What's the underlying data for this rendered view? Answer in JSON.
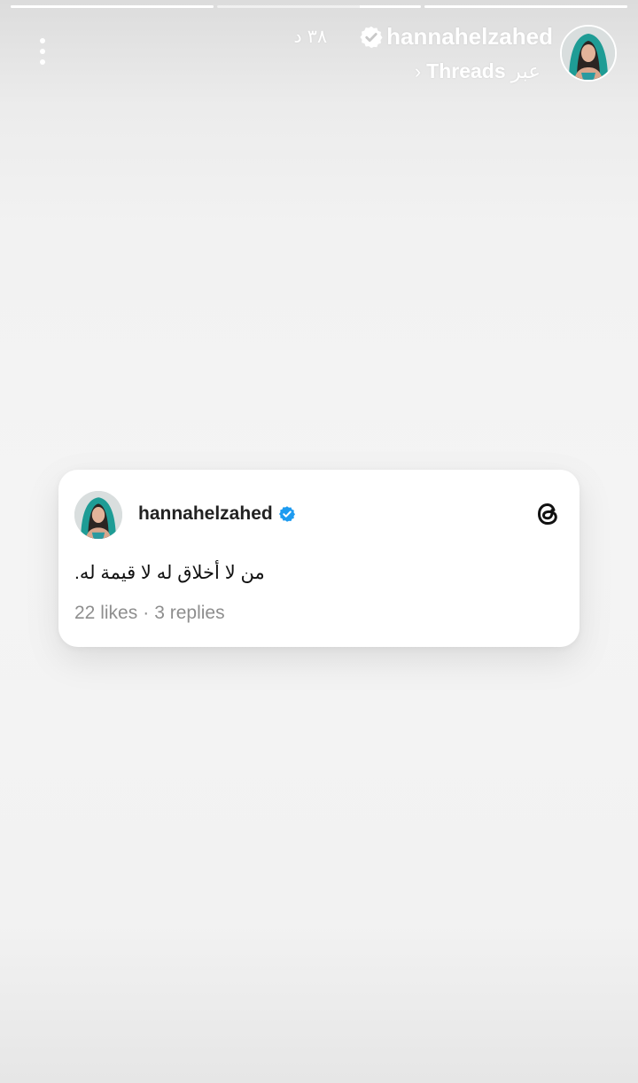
{
  "story": {
    "progress": [
      1,
      0.3,
      1
    ],
    "username": "hannahelzahed",
    "time_ago": "٣٨ د",
    "via_prefix": "عبر",
    "via_app": "Threads",
    "via_chevron": "›"
  },
  "card": {
    "username": "hannahelzahed",
    "text": "من لا أخلاق له لا قيمة له.",
    "likes": "22 likes",
    "separator": "·",
    "replies": "3 replies"
  },
  "colors": {
    "verified_blue": "#1d9bf0",
    "text_muted": "#8e8e8e"
  },
  "icons": [
    "more-vertical-icon",
    "verified-badge-icon",
    "threads-logo-icon",
    "chevron-icon"
  ]
}
